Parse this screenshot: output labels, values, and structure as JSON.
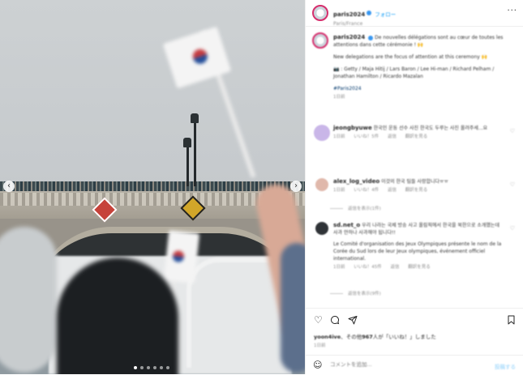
{
  "photo": {
    "prev_icon": "chevron-left-icon",
    "next_icon": "chevron-right-icon",
    "carousel": {
      "slides": 6,
      "active": 1
    }
  },
  "header": {
    "username": "paris2024",
    "follow_label": "フォロー",
    "subtitle": "Paris/France",
    "more_icon": "more-icon"
  },
  "caption": {
    "username": "paris2024",
    "line_fr": "De nouvelles délégations sont au cœur de toutes les attentions dans cette cérémonie ! 🙌",
    "line_en": "New delegations are the focus of attention at this ceremony 🙌",
    "credits": "📷 : Getty / Maja Hitij / Lars Baron / Lee Hi-man / Richard Pelham / Jonathan Hamilton / Ricardo Mazalan",
    "hashtag": "#Paris2024",
    "time": "1日前"
  },
  "comments": [
    {
      "username": "jeongbyuwe",
      "text": "한국인 운동 선수 사진 한국도 두루는 사진 올려주세...요",
      "time": "1日前",
      "likes": "いいね！5件",
      "reply": "返信",
      "translate": "翻訳を見る",
      "avatar_color": "#c9b6e8"
    },
    {
      "username": "alex_log_video",
      "text": "이것의 한국 팀들 사랑합니다ㅠㅠ",
      "time": "1日前",
      "likes": "いいね！4件",
      "reply": "返信",
      "translate": "翻訳を見る",
      "replies_label": "返信を表示(1件)",
      "avatar_color": "#e0b8ab"
    },
    {
      "username": "sd.net_o",
      "text": "우리 나라는 국제 방송 사고 올림픽에서 한국을 북한으로 소개했는데 사과 안하나 사과해야 됩니다!!",
      "text2": "Le Comité d'organisation des Jeux Olympiques présente le nom de la Corée du Sud lors de leur Jeux olympiques, événement officiel international.",
      "time": "1日前",
      "likes": "いいね！45件",
      "reply": "返信",
      "translate": "翻訳を見る",
      "replies_label": "返信を表示(9件)",
      "avatar_color": "#2f3337"
    }
  ],
  "actions": {
    "like_icon": "heart-icon",
    "comment_icon": "comment-icon",
    "share_icon": "share-icon",
    "save_icon": "bookmark-icon"
  },
  "likes": {
    "username": "yoon4ive",
    "text": "その他",
    "count": "967",
    "suffix": "人が「いいね！」しました"
  },
  "date": "1日前",
  "add_comment": {
    "placeholder": "コメントを追加...",
    "post_label": "投稿する",
    "emoji_icon": "smile-icon"
  }
}
